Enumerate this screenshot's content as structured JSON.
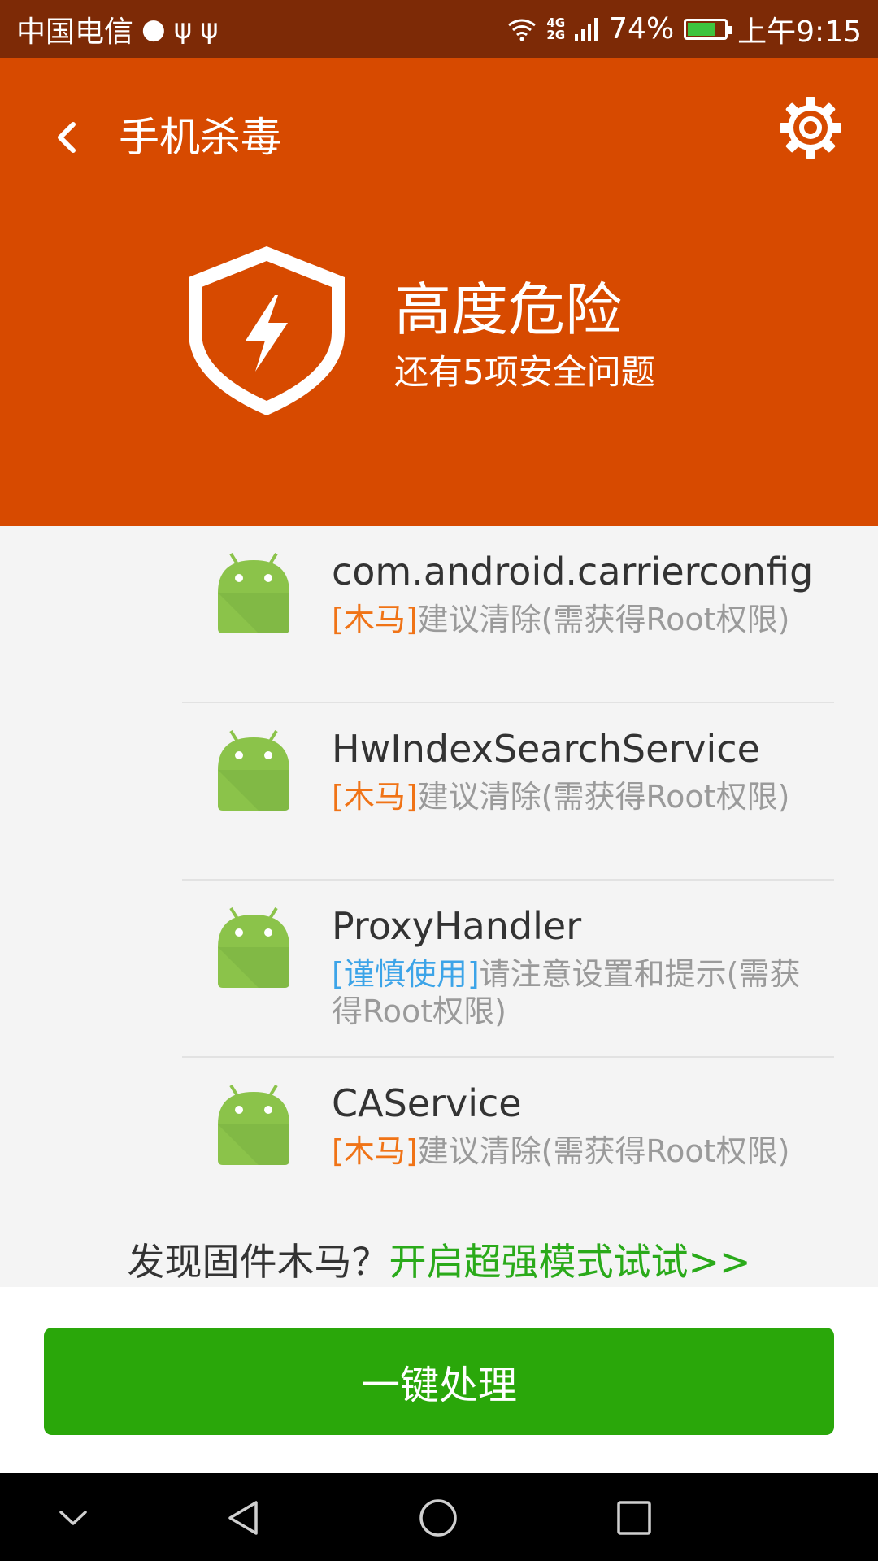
{
  "status_bar": {
    "carrier": "中国电信",
    "network_top": "4G",
    "network_bottom": "2G",
    "battery_percent": "74%",
    "battery_level": 0.74,
    "time": "上午9:15"
  },
  "header": {
    "title": "手机杀毒",
    "risk_level": "高度危险",
    "risk_summary": "还有5项安全问题"
  },
  "items": [
    {
      "name": "com.android.carrierconfig",
      "tag": "[木马]",
      "tag_type": "red",
      "desc": "建议清除(需获得Root权限)"
    },
    {
      "name": "HwIndexSearchService",
      "tag": "[木马]",
      "tag_type": "red",
      "desc": "建议清除(需获得Root权限)"
    },
    {
      "name": "ProxyHandler",
      "tag": "[谨慎使用]",
      "tag_type": "blue",
      "desc": "请注意设置和提示(需获得Root权限)"
    },
    {
      "name": "CAService",
      "tag": "[木马]",
      "tag_type": "red",
      "desc": "建议清除(需获得Root权限)"
    }
  ],
  "promo": {
    "text": "发现固件木马？",
    "link": "开启超强模式试试>>"
  },
  "action_button": "一键处理",
  "colors": {
    "header_bg": "#d74a00",
    "status_bg": "#7d2a06",
    "button_green": "#2aa70a",
    "link_green": "#2aaa1a",
    "tag_red": "#f07316",
    "tag_blue": "#3ca4e8",
    "android_green": "#8bc34a"
  },
  "icons": {
    "back": "back-arrow-icon",
    "settings": "gear-icon",
    "shield": "shield-lightning-icon",
    "app": "android-icon",
    "nav_down": "chevron-down-icon",
    "nav_back": "triangle-back-icon",
    "nav_home": "circle-home-icon",
    "nav_recent": "square-recent-icon"
  }
}
